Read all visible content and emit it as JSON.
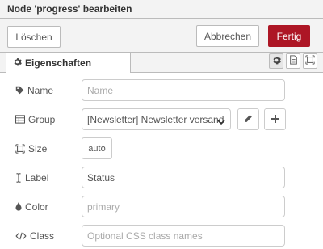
{
  "title": "Node 'progress' bearbeiten",
  "toolbar": {
    "delete_label": "Löschen",
    "cancel_label": "Abbrechen",
    "done_label": "Fertig"
  },
  "tabs": {
    "properties_label": "Eigenschaften"
  },
  "form": {
    "name": {
      "label": "Name",
      "value": "",
      "placeholder": "Name"
    },
    "group": {
      "label": "Group",
      "value": "[Newsletter] Newsletter versand"
    },
    "size": {
      "label": "Size",
      "value": "auto"
    },
    "label": {
      "label": "Label",
      "value": "Status",
      "placeholder": ""
    },
    "color": {
      "label": "Color",
      "value": "",
      "placeholder": "primary"
    },
    "class": {
      "label": "Class",
      "value": "",
      "placeholder": "Optional CSS class names"
    }
  },
  "colors": {
    "done_button": "#ad1625",
    "header_bg": "#f3f3f3",
    "border": "#bbbbbb"
  },
  "icons": {
    "settings_tab": "gear-icon",
    "description_tab": "file-icon",
    "appearance_tab": "frame-icon",
    "name": "tag-icon",
    "group": "table-icon",
    "size": "resize-icon",
    "label": "text-cursor-icon",
    "color": "droplet-icon",
    "class": "code-icon",
    "edit_group": "pencil-icon",
    "add_group": "plus-icon"
  }
}
